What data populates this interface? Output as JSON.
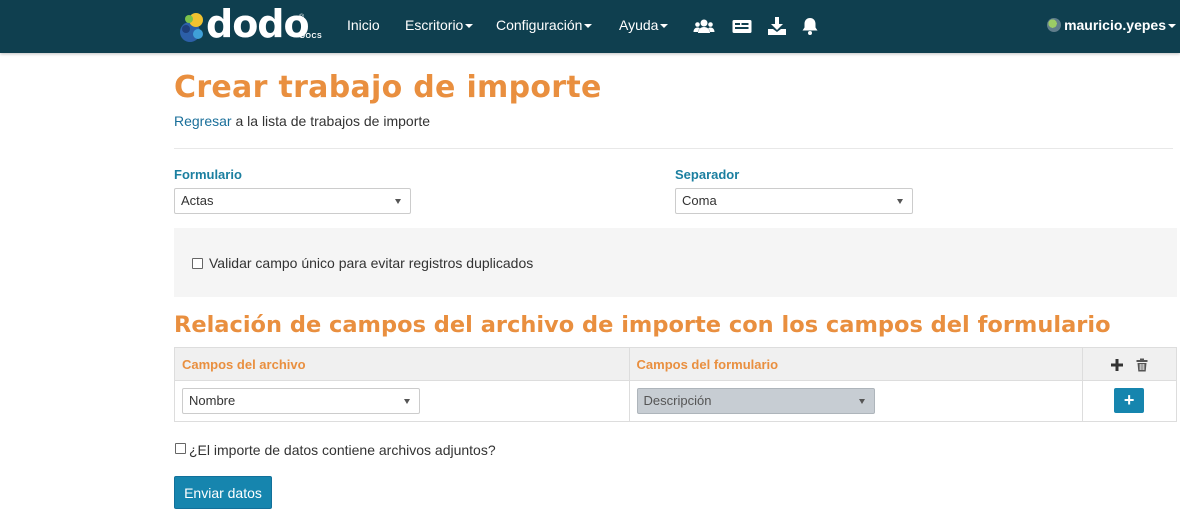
{
  "nav": {
    "logo_text": "dodo",
    "logo_docs": "DOCS",
    "logo_reg": "®",
    "items": [
      {
        "label": "Inicio",
        "has_caret": false
      },
      {
        "label": "Escritorio",
        "has_caret": true
      },
      {
        "label": "Configuración",
        "has_caret": true
      },
      {
        "label": "Ayuda",
        "has_caret": true
      }
    ],
    "icons": [
      "users-icon",
      "id-card-icon",
      "download-icon",
      "bell-icon"
    ],
    "user": "mauricio.yepes"
  },
  "page": {
    "title": "Crear trabajo de importe",
    "back_link": "Regresar",
    "back_suffix": " a la lista de trabajos de importe"
  },
  "form": {
    "formulario_label": "Formulario",
    "formulario_value": "Actas",
    "separador_label": "Separador",
    "separador_value": "Coma",
    "validate_label": "Validar campo único para evitar registros duplicados",
    "validate_checked": false
  },
  "mapping": {
    "title": "Relación de campos del archivo de importe con los campos del formulario",
    "col_file": "Campos del archivo",
    "col_form": "Campos del formulario",
    "row": {
      "file_field": "Nombre",
      "form_field": "Descripción"
    },
    "add_row_label": "+"
  },
  "attachments_label": "¿El importe de datos contiene archivos adjuntos?",
  "attachments_checked": false,
  "submit_label": "Enviar datos",
  "colors": {
    "navbar": "#0f3f4f",
    "heading": "#e98f3f",
    "label": "#1b7fa0",
    "primary_button": "#1685ae"
  }
}
